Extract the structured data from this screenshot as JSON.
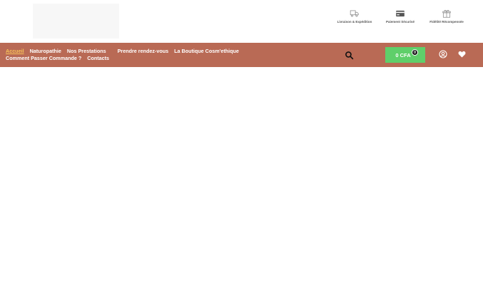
{
  "header": {
    "features": [
      {
        "label": "Livraison & Expédition",
        "icon": "truck-icon"
      },
      {
        "label": "Paiement Sécurisé",
        "icon": "credit-card-icon"
      },
      {
        "label": "Fidélité Récompensée",
        "icon": "gift-icon"
      }
    ]
  },
  "nav": {
    "items": [
      {
        "label": "Accueil",
        "active": true
      },
      {
        "label": "Naturopathie"
      },
      {
        "label": "Nos Prestations"
      },
      {
        "label": "Prendre rendez-vous"
      },
      {
        "label": "La Boutique Cosm'ethique"
      },
      {
        "label": "Comment Passer Commande ?"
      },
      {
        "label": "Contacts"
      }
    ]
  },
  "cart": {
    "amount": "0 CFA",
    "count": "0"
  },
  "colors": {
    "navbar": "#b96a55",
    "cart": "#5fcf6a",
    "active_link": "#f7c25a"
  }
}
